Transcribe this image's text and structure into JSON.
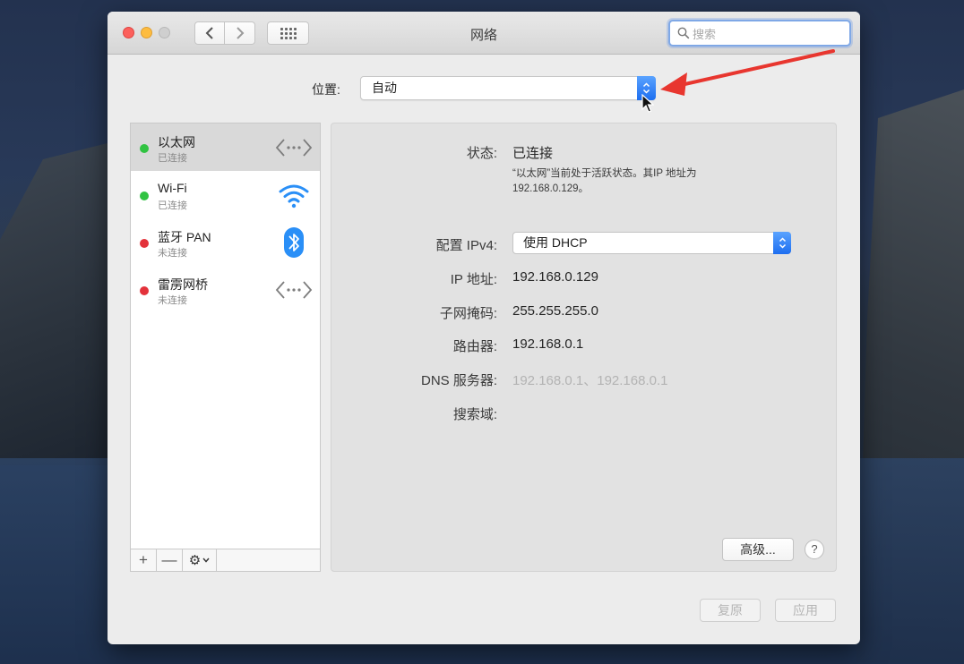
{
  "window": {
    "title": "网络",
    "search_placeholder": "搜索"
  },
  "location": {
    "label": "位置:",
    "value": "自动"
  },
  "services": [
    {
      "name": "以太网",
      "status": "已连接",
      "status_color": "#31c342",
      "icon": "ethernet-icon",
      "selected": true
    },
    {
      "name": "Wi-Fi",
      "status": "已连接",
      "status_color": "#31c342",
      "icon": "wifi-icon",
      "selected": false
    },
    {
      "name": "蓝牙 PAN",
      "status": "未连接",
      "status_color": "#e3323b",
      "icon": "bluetooth-icon",
      "selected": false
    },
    {
      "name": "雷雳网桥",
      "status": "未连接",
      "status_color": "#e3323b",
      "icon": "thunderbolt-bridge-icon",
      "selected": false
    }
  ],
  "sidebar_toolbar": {
    "add": "+",
    "remove": "—",
    "gear": "⚙"
  },
  "detail": {
    "status_label": "状态:",
    "status_value": "已连接",
    "status_desc_line1": "“以太网”当前处于活跃状态。其IP 地址为",
    "status_desc_line2": "192.168.0.129。",
    "ipv4_label": "配置 IPv4:",
    "ipv4_value": "使用 DHCP",
    "ip_label": "IP 地址:",
    "ip_value": "192.168.0.129",
    "mask_label": "子网掩码:",
    "mask_value": "255.255.255.0",
    "router_label": "路由器:",
    "router_value": "192.168.0.1",
    "dns_label": "DNS 服务器:",
    "dns_value": "192.168.0.1、192.168.0.1",
    "search_domain_label": "搜索域:",
    "advanced_button": "高级...",
    "help_button": "?"
  },
  "footer": {
    "revert_button": "复原",
    "apply_button": "应用"
  },
  "colors": {
    "accent_blue": "#1d6ef0",
    "annotation_red": "#e8362f"
  }
}
